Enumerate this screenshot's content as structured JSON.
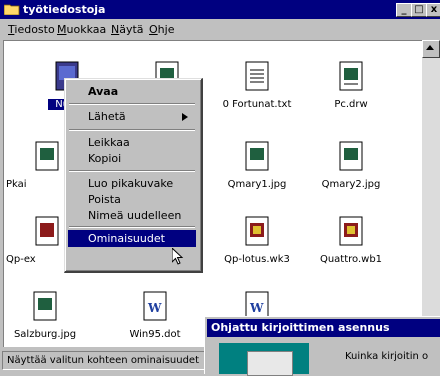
{
  "window": {
    "title": "työtiedostoja"
  },
  "titlebar_buttons": {
    "minimize": "_",
    "maximize": "□",
    "close": "x"
  },
  "menu": [
    {
      "label": "Tiedosto",
      "key": "T",
      "rest": "iedosto"
    },
    {
      "label": "Muokkaa",
      "key": "M",
      "rest": "uokkaa"
    },
    {
      "label": "Näytä",
      "key": "N",
      "rest": "äytä"
    },
    {
      "label": "Ohje",
      "key": "O",
      "rest": "hje"
    }
  ],
  "files": [
    {
      "name": "Nuk",
      "icon": "image-file-icon"
    },
    {
      "name": "",
      "icon": "image-file-icon"
    },
    {
      "name": "0 Fortunat.txt",
      "icon": "text-file-icon"
    },
    {
      "name": "Pc.drw",
      "icon": "drawing-file-icon"
    },
    {
      "name": "Pkai",
      "icon": "image-file-icon"
    },
    {
      "name": "Qmary1.jpg",
      "icon": "image-file-icon"
    },
    {
      "name": "Qmary2.jpg",
      "icon": "image-file-icon"
    },
    {
      "name": "Qp-ex",
      "icon": "spreadsheet-file-icon"
    },
    {
      "name": "Qp-lotus.wk3",
      "icon": "spreadsheet-file-icon"
    },
    {
      "name": "Quattro.wb1",
      "icon": "spreadsheet-file-icon"
    },
    {
      "name": "Salzburg.jpg",
      "icon": "image-file-icon"
    },
    {
      "name": "Win95.dot",
      "icon": "word-document-icon"
    },
    {
      "name": "",
      "icon": "word-document-icon"
    }
  ],
  "context_menu": {
    "open": "Avaa",
    "send_to": "Lähetä",
    "cut": "Leikkaa",
    "copy": "Kopioi",
    "create_shortcut": "Luo pikakuvake",
    "delete": "Poista",
    "rename": "Nimeä uudelleen",
    "properties": "Ominaisuudet"
  },
  "status": {
    "text": "Näyttää valitun kohteen ominaisuudet"
  },
  "dialog": {
    "title": "Ohjattu kirjoittimen asennus",
    "text": "Kuinka kirjoitin o"
  }
}
